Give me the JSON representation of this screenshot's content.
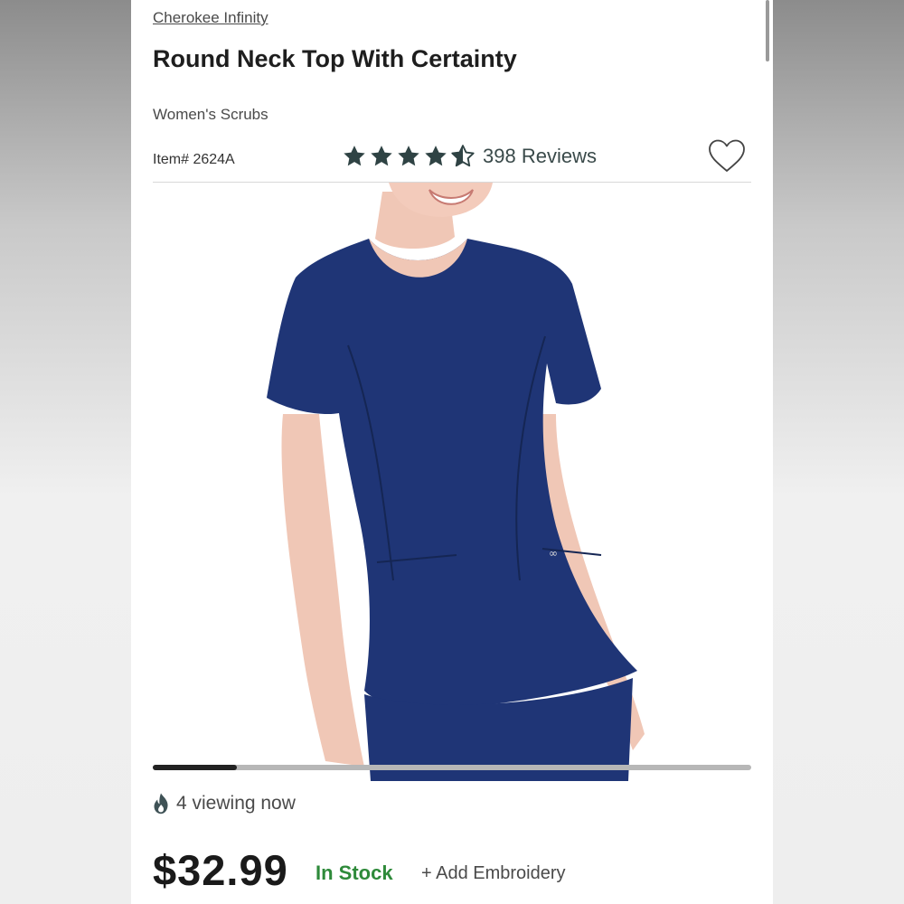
{
  "product": {
    "brand": "Cherokee Infinity",
    "title": "Round Neck Top With Certainty",
    "category": "Women's Scrubs",
    "item_number": "Item# 2624A",
    "rating": 4.5,
    "reviews_label": "398 Reviews",
    "price": "$32.99",
    "stock_status": "In Stock",
    "embroidery_link": "+ Add Embroidery"
  },
  "social_proof": {
    "viewing_now": "4 viewing now"
  },
  "carousel": {
    "progress": 0.14
  },
  "icons": {
    "rating_star": "star-icon",
    "wishlist": "heart-icon",
    "viewing": "flame-icon"
  },
  "colors": {
    "star": "#2f4344",
    "in_stock": "#2e8a3a",
    "product_color": "#1f3576"
  }
}
